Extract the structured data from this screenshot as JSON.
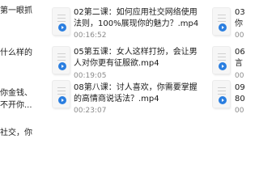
{
  "files": [
    {
      "id": "left1",
      "line1": "第一眼抓",
      "line2": "",
      "duration": ""
    },
    {
      "id": "left2",
      "line1": "什么样的",
      "line2": "",
      "duration": ""
    },
    {
      "id": "left3",
      "line1": "你金钱、",
      "line2": "不开你...",
      "duration": ""
    },
    {
      "id": "left4",
      "line1": "社交，你",
      "line2": "",
      "duration": ""
    },
    {
      "id": "mid1",
      "line1": "02第二课：如何应用社交网络使用",
      "line2": "法则，100%展现你的魅力？.mp4",
      "duration": "00:16:52"
    },
    {
      "id": "mid2",
      "line1": "05第五课：女人这样打扮，会让男",
      "line2": "人对你更有征服欲.mp4",
      "duration": "00:19:05"
    },
    {
      "id": "mid3",
      "line1": "08第八课：讨人喜欢，你需要掌握",
      "line2": "的高情商说话法？.mp4",
      "duration": "00:23:07"
    },
    {
      "id": "right1",
      "line1": "03",
      "line2": "你",
      "duration": "00"
    },
    {
      "id": "right2",
      "line1": "06",
      "line2": "言",
      "duration": "00"
    },
    {
      "id": "right3",
      "line1": "09",
      "line2": "80",
      "duration": "00"
    }
  ],
  "colors": {
    "play_badge": "#2a7ee0",
    "duration_text": "#8a8a8a"
  },
  "icons": {
    "file_thumb": "video-file-icon"
  }
}
